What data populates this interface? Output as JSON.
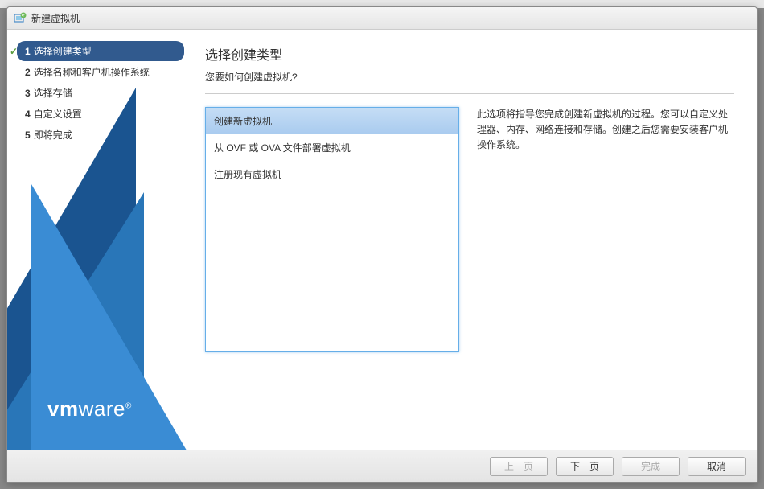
{
  "titlebar": {
    "title": "新建虚拟机"
  },
  "steps": [
    {
      "num": "1",
      "label": "选择创建类型",
      "active": true,
      "checked": true
    },
    {
      "num": "2",
      "label": "选择名称和客户机操作系统",
      "active": false,
      "checked": false
    },
    {
      "num": "3",
      "label": "选择存储",
      "active": false,
      "checked": false
    },
    {
      "num": "4",
      "label": "自定义设置",
      "active": false,
      "checked": false
    },
    {
      "num": "5",
      "label": "即将完成",
      "active": false,
      "checked": false
    }
  ],
  "content": {
    "title": "选择创建类型",
    "subtitle": "您要如何创建虚拟机?"
  },
  "options": [
    {
      "label": "创建新虚拟机",
      "selected": true
    },
    {
      "label": "从 OVF 或 OVA 文件部署虚拟机",
      "selected": false
    },
    {
      "label": "注册现有虚拟机",
      "selected": false
    }
  ],
  "description": "此选项将指导您完成创建新虚拟机的过程。您可以自定义处理器、内存、网络连接和存储。创建之后您需要安装客户机操作系统。",
  "logo": {
    "part1": "vm",
    "part2": "ware"
  },
  "buttons": {
    "back": "上一页",
    "next": "下一页",
    "finish": "完成",
    "cancel": "取消"
  }
}
